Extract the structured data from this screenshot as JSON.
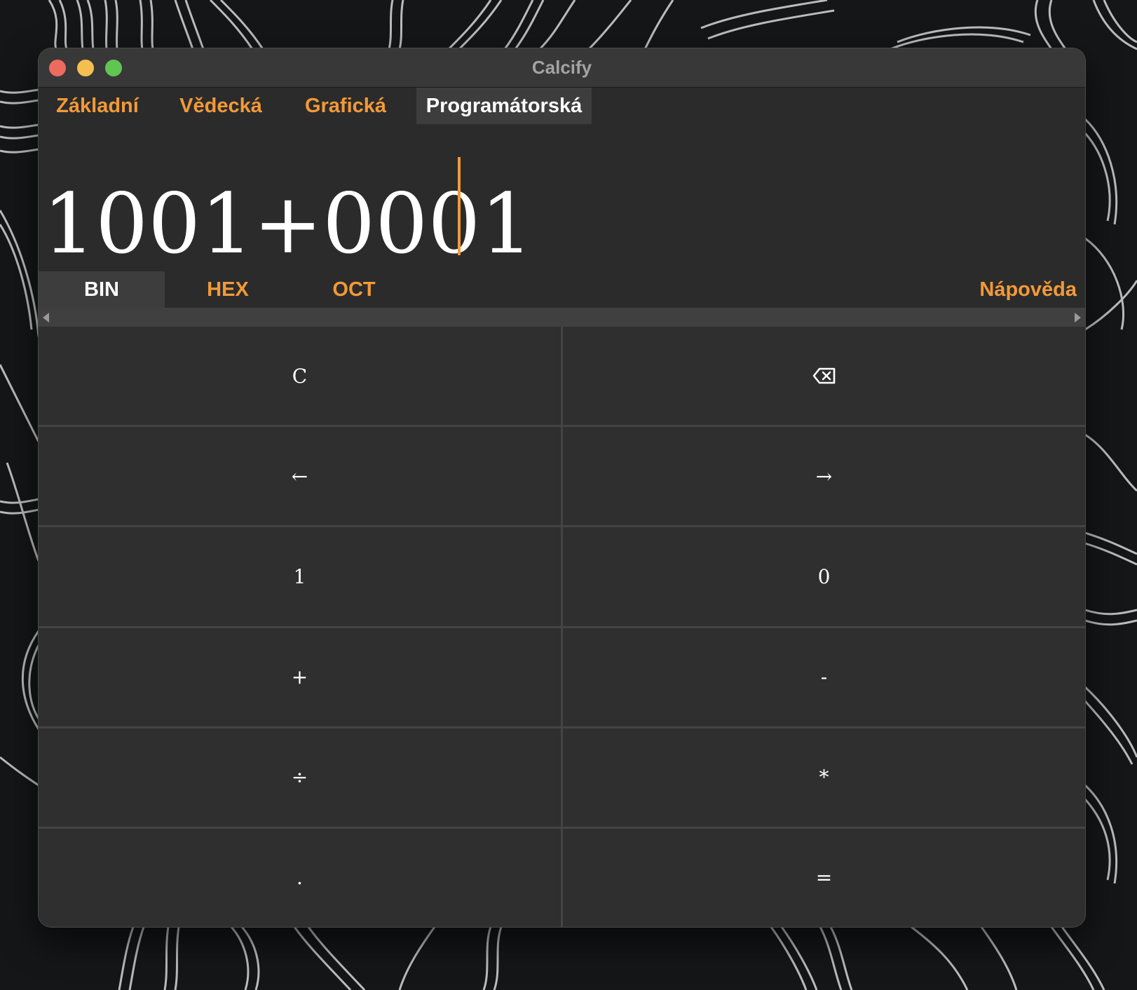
{
  "window": {
    "title": "Calcify"
  },
  "modes": [
    {
      "label": "Základní",
      "active": false
    },
    {
      "label": "Vědecká",
      "active": false
    },
    {
      "label": "Grafická",
      "active": false
    },
    {
      "label": "Programátorská",
      "active": true
    }
  ],
  "display": {
    "expression": "1001+0001"
  },
  "bases": [
    {
      "label": "BIN",
      "active": true
    },
    {
      "label": "HEX",
      "active": false
    },
    {
      "label": "OCT",
      "active": false
    }
  ],
  "help_label": "Nápověda",
  "keys": {
    "clear": "C",
    "backspace_icon": "backspace-icon",
    "left": "←",
    "right": "→",
    "one": "1",
    "zero": "0",
    "plus": "+",
    "minus": "-",
    "divide": "÷",
    "multiply": "*",
    "decimal": ".",
    "equals": "="
  },
  "colors": {
    "accent": "#f29a38",
    "background": "#2b2b2b",
    "key": "#2f2f2f",
    "active_tab": "#3d3d3d"
  }
}
